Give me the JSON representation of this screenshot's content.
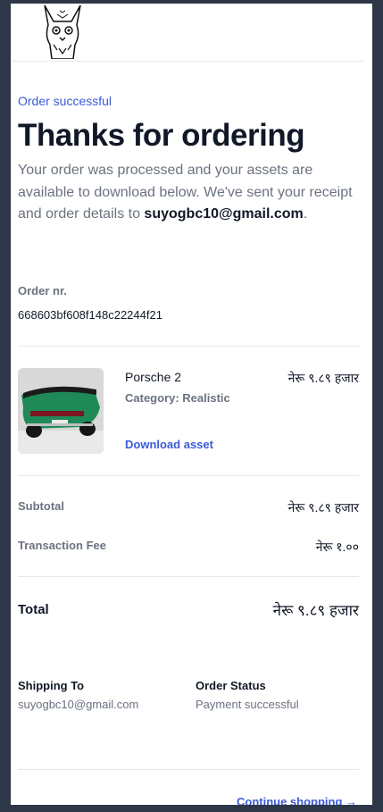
{
  "header": {
    "logo_icon": "fox-cat-logo-icon"
  },
  "hero": {
    "eyebrow": "Order successful",
    "title": "Thanks for ordering",
    "desc_prefix": "Your order was processed and your assets are available to download below. We've sent your receipt and order details to ",
    "email": "suyogbc10@gmail.com",
    "desc_suffix": "."
  },
  "order": {
    "label": "Order nr.",
    "id": "668603bf608f148c22244f21"
  },
  "product": {
    "name": "Porsche 2",
    "price": "नेरू ९.८९ हजार",
    "category": "Category: Realistic",
    "download_label": "Download asset",
    "image_icon": "green-porsche-thumbnail"
  },
  "summary": {
    "subtotal_label": "Subtotal",
    "subtotal_value": "नेरू ९.८९ हजार",
    "fee_label": "Transaction Fee",
    "fee_value": "नेरू १.००",
    "total_label": "Total",
    "total_value": "नेरू ९.८९ हजार"
  },
  "shipping": {
    "label": "Shipping To",
    "value": "suyogbc10@gmail.com"
  },
  "status": {
    "label": "Order Status",
    "value": "Payment successful"
  },
  "footer": {
    "continue_label": "Continue shopping →"
  },
  "colors": {
    "accent": "#3b5bd6",
    "frame": "#2d3748",
    "text": "#111827",
    "muted": "#6b7280"
  }
}
